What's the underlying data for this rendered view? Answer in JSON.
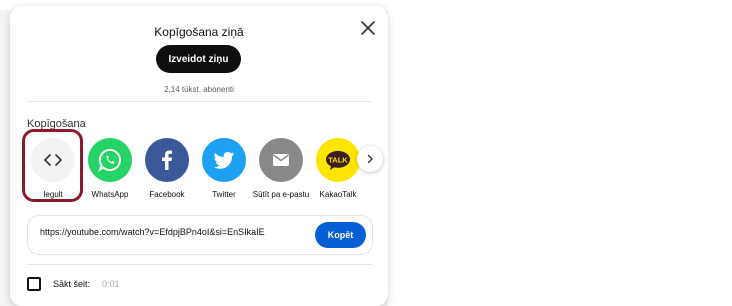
{
  "dialog": {
    "title": "Kopīgošana ziņā",
    "create_post_label": "Izveidot ziņu",
    "subscribers": "2,14 tūkst. abonenti",
    "share_section_label": "Kopīgošana"
  },
  "share_targets": [
    {
      "label": "Iegult",
      "icon": "embed-icon",
      "color": "#f2f2f2"
    },
    {
      "label": "WhatsApp",
      "icon": "whatsapp-icon",
      "color": "#25d366"
    },
    {
      "label": "Facebook",
      "icon": "facebook-icon",
      "color": "#3b5998"
    },
    {
      "label": "Twitter",
      "icon": "twitter-icon",
      "color": "#1da1f2"
    },
    {
      "label": "Sūtīt pa e-pastu",
      "icon": "email-icon",
      "color": "#888888"
    },
    {
      "label": "KakaoTalk",
      "icon": "kakaotalk-icon",
      "color": "#fee500"
    }
  ],
  "link": {
    "url": "https://youtube.com/watch?v=EfdpjBPn4oI&si=EnSIkaIE",
    "copy_label": "Kopēt"
  },
  "start_at": {
    "label": "Sākt šeit:",
    "time": "0:01"
  },
  "colors": {
    "highlight": "#8b1a2e",
    "accent": "#065fd4"
  }
}
